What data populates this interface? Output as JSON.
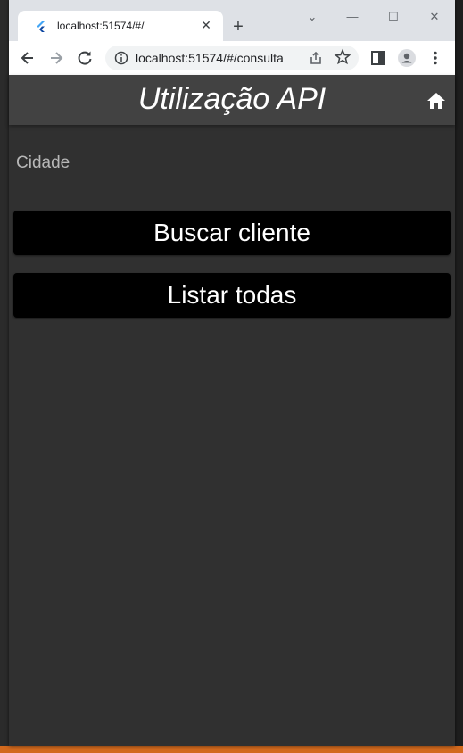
{
  "browser": {
    "tab_title": "localhost:51574/#/",
    "tab_close": "✕",
    "new_tab": "+",
    "url": "localhost:51574/#/consulta",
    "window_controls": {
      "minimize": "—",
      "maximize": "☐",
      "close": "✕",
      "menu": "⌄"
    }
  },
  "app": {
    "title": "Utilização API",
    "field_label": "Cidade",
    "buttons": {
      "search": "Buscar cliente",
      "list_all": "Listar todas"
    }
  },
  "icons": [
    "flutter-icon",
    "back-icon",
    "forward-icon",
    "reload-icon",
    "info-icon",
    "share-icon",
    "star-icon",
    "sidepanel-icon",
    "profile-icon",
    "more-icon",
    "home-icon"
  ],
  "colors": {
    "app_bar": "#424242",
    "background": "#303030",
    "button": "#000000",
    "titlebar": "#dee1e6"
  }
}
